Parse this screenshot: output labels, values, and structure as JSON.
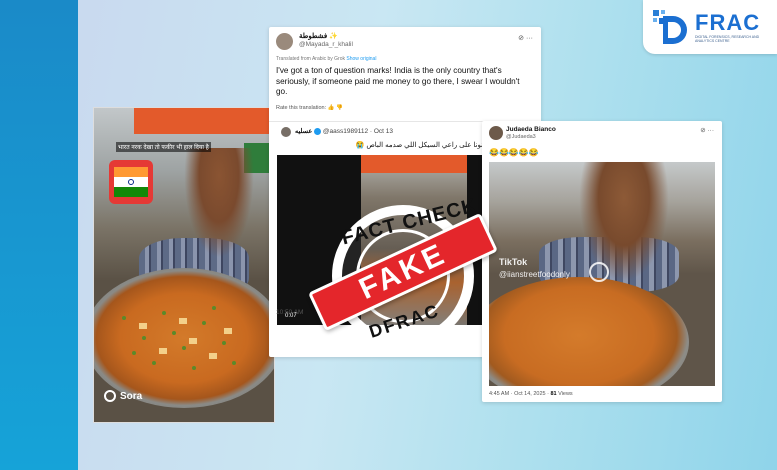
{
  "logo": {
    "text": "FRAC",
    "tagline": "DIGITAL FORENSICS, RESEARCH AND ANALYTICS CENTRE"
  },
  "left_video": {
    "caption": "भारत नरक देखा तो फकीर भी हाल दिया है",
    "watermark": "Sora"
  },
  "tweet_top": {
    "name": "فشطوطة ✨",
    "handle": "@Mayada_r_khalil",
    "translated_note": "Translated from Arabic by Grok",
    "show_original": "Show original",
    "text": "I've got a ton of question marks! India is the only country that's seriously, if someone paid me money to go there, I swear I wouldn't go.",
    "rate_label": "Rate this translation:",
    "inner": {
      "name": "عسليه",
      "handle": "@aass1989112 · Oct 13",
      "arabic_text": "يجه طمنونا على راعي السيكل اللي صدمه الباص 😭",
      "video_time": "0:07"
    },
    "timestamp": "10:50 AM"
  },
  "tweet_right": {
    "name": "Judaeda Bianco",
    "handle": "@Judaeda3",
    "emojis": "😂😂😂😂😂",
    "tiktok_label": "TikTok",
    "tiktok_handle": "@iianstreetfoodonly",
    "timestamp": "4:45 AM · Oct 14, 2025 · ",
    "views_count": "81",
    "views_label": " Views"
  },
  "stamp": {
    "top_text": "FACT CHECK",
    "fake_text": "FAKE",
    "bottom_text": "DFRAC"
  },
  "colors": {
    "brand": "#1b6fd1",
    "fake_red": "#e4262b",
    "accent_blue": "#1d9bf0"
  }
}
